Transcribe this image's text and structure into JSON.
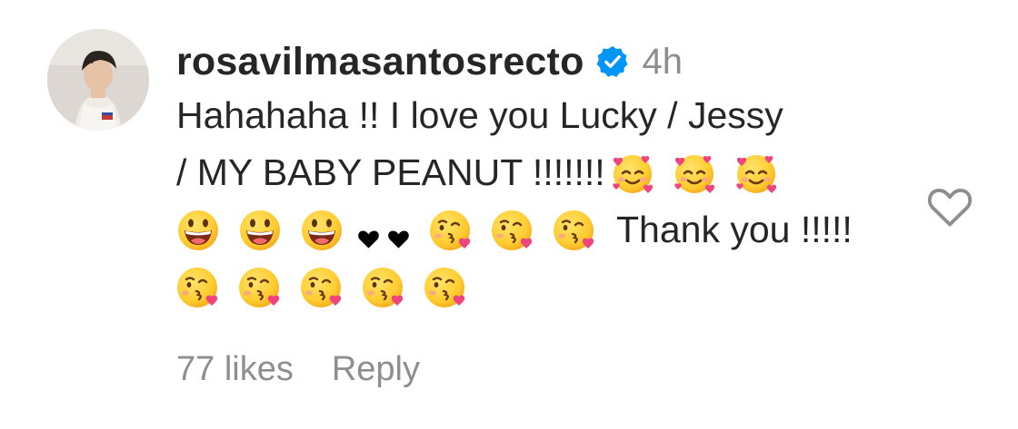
{
  "comment": {
    "username": "rosavilmasantosrecto",
    "verified_icon": "verified-badge-icon",
    "timestamp": "4h",
    "text_line1": "Hahahaha !! I love you Lucky / Jessy",
    "text_line2": "/ MY BABY PEANUT !!!!!!!",
    "text_line3": "Thank you !!!!!",
    "likes": "77 likes",
    "reply_label": "Reply",
    "like_icon": "heart-outline-icon"
  },
  "colors": {
    "text": "#262626",
    "muted": "#8e8e8e",
    "verified": "#0095f6",
    "emoji_face": "#ffcc2f",
    "emoji_heart": "#f0447f"
  }
}
